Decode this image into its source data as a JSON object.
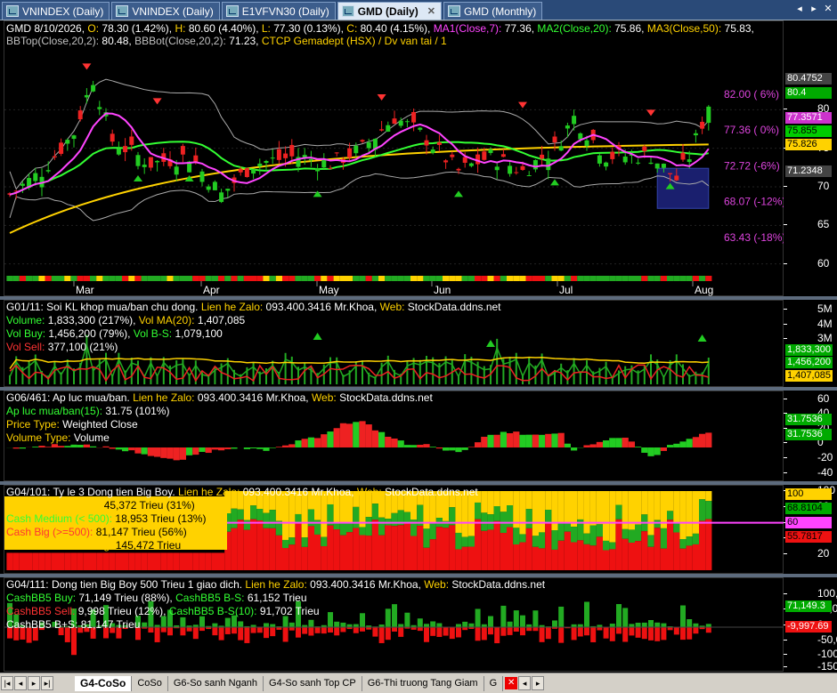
{
  "tabs": [
    {
      "label": "VNINDEX (Daily)",
      "active": false
    },
    {
      "label": "VNINDEX (Daily)",
      "active": false
    },
    {
      "label": "E1VFVN30 (Daily)",
      "active": false
    },
    {
      "label": "GMD (Daily)",
      "active": true
    },
    {
      "label": "GMD (Monthly)",
      "active": false
    }
  ],
  "price_pane": {
    "line1": [
      {
        "t": "GMD 8/10/2026, ",
        "c": "#ffffff"
      },
      {
        "t": "O: ",
        "c": "#ffd200"
      },
      {
        "t": "78.30 (1.42%), ",
        "c": "#ffffff"
      },
      {
        "t": "H: ",
        "c": "#ffd200"
      },
      {
        "t": "80.60 (4.40%), ",
        "c": "#ffffff"
      },
      {
        "t": "L: ",
        "c": "#ffd200"
      },
      {
        "t": "77.30 (0.13%), ",
        "c": "#ffffff"
      },
      {
        "t": "C: ",
        "c": "#ffd200"
      },
      {
        "t": "80.40 (4.15%), ",
        "c": "#ffffff"
      },
      {
        "t": "MA1(Close,7): ",
        "c": "#ff44ff"
      },
      {
        "t": "77.36, ",
        "c": "#ffffff"
      },
      {
        "t": "MA2(Close,20): ",
        "c": "#33ff33"
      },
      {
        "t": "75.86, ",
        "c": "#ffffff"
      },
      {
        "t": "MA3(Close,50): ",
        "c": "#ffd200"
      },
      {
        "t": "75.83,",
        "c": "#ffffff"
      }
    ],
    "line2": [
      {
        "t": "BBTop(Close,20,2): ",
        "c": "#c0c0c0"
      },
      {
        "t": "80.48, ",
        "c": "#ffffff"
      },
      {
        "t": "BBBot(Close,20,2): ",
        "c": "#c0c0c0"
      },
      {
        "t": "71.23, ",
        "c": "#ffffff"
      },
      {
        "t": "CTCP Gemadept (HSX) / Dv van tai / 1",
        "c": "#ffd200"
      }
    ],
    "levels": [
      "82.00 ( 6%)",
      "77.36 ( 0%)",
      "72.72 (-6%)",
      "68.07 (-12%)",
      "63.43 (-18%)"
    ],
    "ticks": [
      "80",
      "75",
      "70",
      "65",
      "60"
    ],
    "tags": [
      {
        "text": "80.4752",
        "bg": "#444444",
        "fg": "#ffffff"
      },
      {
        "text": "80.4",
        "bg": "#00aa00",
        "fg": "#ffffff"
      },
      {
        "text": "77.3571",
        "bg": "#cc33cc",
        "fg": "#ffffff"
      },
      {
        "text": "75.855",
        "bg": "#00cc00",
        "fg": "#000000"
      },
      {
        "text": "75.826",
        "bg": "#ffd200",
        "fg": "#000000"
      },
      {
        "text": "71.2348",
        "bg": "#444444",
        "fg": "#ffffff"
      }
    ],
    "months": [
      "Mar",
      "Apr",
      "May",
      "Jun",
      "Jul",
      "Aug"
    ]
  },
  "volume_pane": {
    "header": [
      {
        "t": "G01/11: ",
        "c": "#ffffff"
      },
      {
        "t": "Soi KL khop mua/ban chu dong. ",
        "c": "#ffffff"
      },
      {
        "t": "Lien he Zalo: ",
        "c": "#ffd200"
      },
      {
        "t": "093.400.3416 Mr.Khoa, ",
        "c": "#ffffff"
      },
      {
        "t": "Web: ",
        "c": "#ffd200"
      },
      {
        "t": "StockData.ddns.net",
        "c": "#ffffff"
      }
    ],
    "rows": [
      [
        {
          "t": "Volume: ",
          "c": "#33ff33"
        },
        {
          "t": "1,833,300 (217%), ",
          "c": "#ffffff"
        },
        {
          "t": "Vol MA(20): ",
          "c": "#ffd200"
        },
        {
          "t": "1,407,085",
          "c": "#ffffff"
        }
      ],
      [
        {
          "t": "Vol Buy: ",
          "c": "#33ff33"
        },
        {
          "t": "1,456,200 (79%), ",
          "c": "#ffffff"
        },
        {
          "t": "Vol B-S: ",
          "c": "#33ff33"
        },
        {
          "t": "1,079,100",
          "c": "#ffffff"
        }
      ],
      [
        {
          "t": "Vol Sell: ",
          "c": "#ff3333"
        },
        {
          "t": "377,100 (21%)",
          "c": "#ffffff"
        }
      ]
    ],
    "ticks": [
      "5M",
      "4M",
      "3M"
    ],
    "tags": [
      {
        "text": "1,833,300",
        "bg": "#00aa00",
        "fg": "#ffffff"
      },
      {
        "text": "1,456,200",
        "bg": "#00aa00",
        "fg": "#ffffff"
      },
      {
        "text": "1,407,085",
        "bg": "#ffd200",
        "fg": "#000000"
      }
    ]
  },
  "pressure_pane": {
    "header": [
      {
        "t": "G06/461: ",
        "c": "#ffffff"
      },
      {
        "t": "Ap luc mua/ban. ",
        "c": "#ffffff"
      },
      {
        "t": "Lien he Zalo: ",
        "c": "#ffd200"
      },
      {
        "t": "093.400.3416 Mr.Khoa, ",
        "c": "#ffffff"
      },
      {
        "t": "Web: ",
        "c": "#ffd200"
      },
      {
        "t": "StockData.ddns.net",
        "c": "#ffffff"
      }
    ],
    "rows": [
      [
        {
          "t": "Ap luc mua/ban(15): ",
          "c": "#33ff33"
        },
        {
          "t": "31.75 (101%)",
          "c": "#ffffff"
        }
      ],
      [
        {
          "t": "Price Type: ",
          "c": "#ffd200"
        },
        {
          "t": "Weighted Close",
          "c": "#ffffff"
        }
      ],
      [
        {
          "t": "Volume Type: ",
          "c": "#ffd200"
        },
        {
          "t": "Volume",
          "c": "#ffffff"
        }
      ]
    ],
    "ticks": [
      "60",
      "40",
      "20",
      "0",
      "-20",
      "-40"
    ],
    "tags": [
      {
        "text": "31.7536",
        "bg": "#00aa00",
        "fg": "#ffffff"
      },
      {
        "text": "31.7536",
        "bg": "#00aa00",
        "fg": "#ffffff"
      }
    ]
  },
  "bigboy_pane": {
    "header": [
      {
        "t": "G04/101: ",
        "c": "#ffffff"
      },
      {
        "t": "Ty le 3 Dong tien Big Boy. ",
        "c": "#ffffff"
      },
      {
        "t": "Lien he Zalo: ",
        "c": "#ffd200"
      },
      {
        "t": "093.400.3416 Mr.Khoa, ",
        "c": "#ffffff"
      },
      {
        "t": "Web: ",
        "c": "#ffd200"
      },
      {
        "t": "StockData.ddns.net",
        "c": "#ffffff"
      }
    ],
    "rows": [
      [
        {
          "t": "Cash Small (< 200): ",
          "c": "#ffd200"
        },
        {
          "t": "45,372 Trieu (31%)",
          "c": "#000000"
        }
      ],
      [
        {
          "t": "Cash Medium (< 500): ",
          "c": "#33ff33"
        },
        {
          "t": "18,953 Trieu (13%)",
          "c": "#000000"
        }
      ],
      [
        {
          "t": "Cash Big (>=500): ",
          "c": "#ff3333"
        },
        {
          "t": "81,147 Trieu (56%)",
          "c": "#000000"
        }
      ],
      [
        {
          "t": "Cash Small+Med+Big: ",
          "c": "#ffd200"
        },
        {
          "t": "145,472 Trieu",
          "c": "#000000"
        }
      ]
    ],
    "ticks": [
      "100",
      "80",
      "60",
      "40",
      "20"
    ],
    "tags": [
      {
        "text": "100",
        "bg": "#ffd200",
        "fg": "#000000"
      },
      {
        "text": "68.8104",
        "bg": "#00aa00",
        "fg": "#000000"
      },
      {
        "text": "60",
        "bg": "#ff44ff",
        "fg": "#000000"
      },
      {
        "text": "55.7817",
        "bg": "#ee1111",
        "fg": "#000000"
      }
    ]
  },
  "bb500_pane": {
    "header": [
      {
        "t": "G04/111: ",
        "c": "#ffffff"
      },
      {
        "t": "Dong tien Big Boy 500 Trieu 1 giao dich. ",
        "c": "#ffffff"
      },
      {
        "t": "Lien he Zalo: ",
        "c": "#ffd200"
      },
      {
        "t": "093.400.3416 Mr.Khoa, ",
        "c": "#ffffff"
      },
      {
        "t": "Web: ",
        "c": "#ffd200"
      },
      {
        "t": "StockData.ddns.net",
        "c": "#ffffff"
      }
    ],
    "rows": [
      [
        {
          "t": "CashBB5 Buy: ",
          "c": "#33ff33"
        },
        {
          "t": "71,149 Trieu (88%), ",
          "c": "#ffffff"
        },
        {
          "t": "CashBB5 B-S: ",
          "c": "#33ff33"
        },
        {
          "t": "61,152 Trieu",
          "c": "#ffffff"
        }
      ],
      [
        {
          "t": "CashBB5 Sell: ",
          "c": "#ff3333"
        },
        {
          "t": "9,998 Trieu (12%), ",
          "c": "#ffffff"
        },
        {
          "t": "CashBB5 B-S(10): ",
          "c": "#33ff33"
        },
        {
          "t": "91,702 Trieu",
          "c": "#ffffff"
        }
      ],
      [
        {
          "t": "CashBB5 B+S: ",
          "c": "#ffffff"
        },
        {
          "t": "81,147 Trieu",
          "c": "#ffffff"
        }
      ]
    ],
    "ticks": [
      "100,000",
      "50,000",
      "0",
      "-50,000",
      "-100,000",
      "-150,000"
    ],
    "tags": [
      {
        "text": "71,149.3",
        "bg": "#00aa00",
        "fg": "#ffffff"
      },
      {
        "text": "-9,997.69",
        "bg": "#ee1111",
        "fg": "#ffffff"
      }
    ]
  },
  "bottom_tabs": [
    "G4-CoSo",
    "CoSo",
    "G6-So sanh Nganh",
    "G4-So sanh Top CP",
    "G6-Thi truong Tang Giam",
    "G"
  ],
  "bottom_active": "G4-CoSo"
}
